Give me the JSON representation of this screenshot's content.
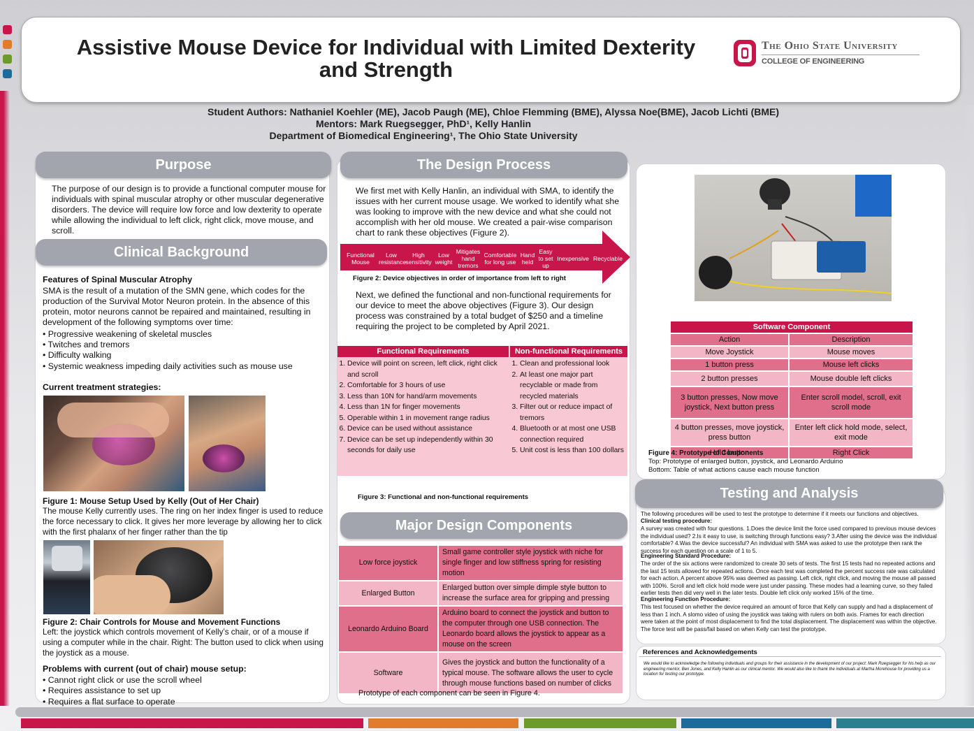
{
  "title": "Assistive Mouse Device for Individual with Limited Dexterity and Strength",
  "university": {
    "name": "The Ohio State University",
    "college": "College of Engineering"
  },
  "authors": {
    "students": "Student Authors: Nathaniel Koehler (ME), Jacob Paugh (ME), Chloe Flemming (BME), Alyssa Noe(BME), Jacob Lichti (BME)",
    "mentors": "Mentors: Mark Ruegsegger, PhD¹, Kelly Hanlin",
    "department": "Department of Biomedical Engineering¹, The Ohio State University"
  },
  "purpose": {
    "heading": "Purpose",
    "text": "The purpose of our design is to provide a functional computer mouse for individuals with spinal muscular atrophy or other muscular degenerative disorders. The device will require low force and low dexterity to operate while allowing the individual to left click, right click, move mouse, and scroll."
  },
  "clinical": {
    "heading": "Clinical Background",
    "features_title": "Features of Spinal Muscular Atrophy",
    "features_text": "SMA is the result of a mutation of the SMN gene, which codes for the production of the Survival Motor Neuron protein. In the absence of this protein, motor neurons cannot be repaired and maintained, resulting in development of the following symptoms over time:",
    "symptoms": [
      "• Progressive weakening of skeletal muscles",
      "• Twitches and tremors",
      "• Difficulty walking",
      "• Systemic weakness impeding daily activities such as mouse use"
    ],
    "treatment_title": "Current treatment strategies:",
    "fig1_caption": "Figure 1: Mouse Setup Used by Kelly (Out of Her Chair)",
    "fig1_text": "The mouse Kelly currently uses. The ring on her index finger is used to reduce the force necessary to click. It gives her more leverage by allowing her to click with the first phalanx of her finger rather than the tip",
    "fig2_caption": "Figure 2: Chair Controls for Mouse and Movement Functions",
    "fig2_text": "Left: the joystick which controls movement of Kelly’s chair, or of a mouse if using a computer while in the chair. Right: The button used to click when using the joystick as a mouse.",
    "problems_title": "Problems with current (out of chair) mouse setup:",
    "problems": [
      "• Cannot right click or use the scroll wheel",
      "• Requires assistance to set up",
      "• Requires a flat surface to operate"
    ]
  },
  "design": {
    "heading": "The Design Process",
    "intro": "We first met with Kelly Hanlin, an individual with SMA, to identify the issues with her current mouse usage. We worked to identify what she was looking to improve with the new device and what she could not accomplish with her old mouse. We created a pair-wise comparison chart to rank these objectives (Figure 2).",
    "objectives": [
      "Functional Mouse",
      "Low resistance",
      "High sensitivity",
      "Low weight",
      "Mitigates hand tremors",
      "Comfortable for long use",
      "Hand held",
      "Easy to set up",
      "Inexpensive",
      "Recyclable"
    ],
    "objectives_caption": "Figure 2: Device objectives in order of importance from left to right",
    "next": "Next, we defined the functional and non-functional requirements for our device to meet the above objectives (Figure 3). Our design process was constrained by a total budget of $250 and a timeline requiring the project to be completed by April 2021.",
    "functional_header": "Functional Requirements",
    "nonfunctional_header": "Non-functional Requirements",
    "functional": [
      "Device will point on screen, left click, right click and scroll",
      "Comfortable for 3 hours of use",
      "Less than 10N for hand/arm movements",
      "Less than 1N for finger movements",
      "Operable within 1 in movement range radius",
      "Device can be used without assistance",
      "Device can be set up independently within 30 seconds for daily use"
    ],
    "nonfunctional": [
      "Clean and professional look",
      "At least one major part recyclable or made from recycled materials",
      "Filter out or reduce impact of tremors",
      "Bluetooth or at most one USB connection required",
      "Unit cost is less than 100 dollars"
    ],
    "fig3_caption": "Figure 3: Functional and non-functional requirements"
  },
  "components": {
    "heading": "Major Design Components",
    "rows": [
      {
        "name": "Low force joystick",
        "desc": "Small game controller style joystick with niche for single finger and low stiffness spring for resisting motion"
      },
      {
        "name": "Enlarged Button",
        "desc": "Enlarged button over simple dimple style button to increase the surface area for gripping and pressing"
      },
      {
        "name": "Leonardo Arduino Board",
        "desc": "Arduino board to connect the joystick and button to the computer through one USB connection. The Leonardo board allows the joystick to appear as a mouse on the screen"
      },
      {
        "name": "Software",
        "desc": "Gives the joystick and button the functionality of a typical mouse. The software allows the user to cycle through mouse functions based on number of clicks"
      }
    ],
    "note": "Prototype of each component can be seen in Figure 4."
  },
  "software": {
    "title": "Software Component",
    "col_action": "Action",
    "col_desc": "Description",
    "rows": [
      {
        "action": "Move Joystick",
        "desc": "Mouse moves"
      },
      {
        "action": "1 button press",
        "desc": "Mouse left clicks"
      },
      {
        "action": "2 button presses",
        "desc": "Mouse double left clicks"
      },
      {
        "action": "3 button presses, Now move joystick, Next button press",
        "desc": "Enter scroll model, scroll, exit scroll mode"
      },
      {
        "action": "4 button presses, move joystick, press button",
        "desc": "Enter left click hold mode, select, exit mode"
      },
      {
        "action": "Hold button",
        "desc": "Right Click"
      }
    ],
    "fig4_caption": "Figure 4: Prototype of Components",
    "fig4_top": "Top: Prototype of enlarged button, joystick, and Leonardo Arduino",
    "fig4_bottom": "Bottom: Table of what actions cause each mouse function"
  },
  "testing": {
    "heading": "Testing and Analysis",
    "intro": "The following procedures will be used to test the prototype to determine if it meets our functions and objectives.",
    "clinical_title": "Clinical testing procedure:",
    "clinical_text": "A survey was created with four questions. 1.Does the device limit the force used compared to previous mouse devices the individual used? 2.Is it easy to use, is switching through functions easy? 3.After using the device was the individual comfortable? 4.Was the device successful? An individual with SMA was asked to use the prototype then rank the success for each question on a scale of 1 to 5.",
    "standard_title": "Engineering Standard Procedure:",
    "standard_text": "The order of the six actions were randomized to create 30 sets of tests. The first 15 tests had no repeated actions and the last 15 tests allowed for repeated actions. Once each test was completed the percent success rate was calculated for each action. A percent above 95% was deemed as passing. Left click, right click, and moving the mouse all passed with 100%. Scroll and left click hold mode were just under passing. These modes had a learning curve, so they failed earlier tests then did very well in the later tests. Double left click only worked 15% of the time.",
    "function_title": "Engineering Function Procedure:",
    "function_text": "This test focused on whether the device required an amount of force that Kelly can supply and had a displacement of less than 1 inch. A slomo video of using the joystick was taking with rulers on both axis. Frames for each direction were taken at the point of most displacement to find the total displacement. The displacement was within the objective. The force test will be pass/fail based on when Kelly can test the prototype."
  },
  "references": {
    "heading": "References and Acknowledgements",
    "text": "We would like to acknowledge the following individuals and groups for their assistance in the development of our project: Mark Ruegsegger for his help as our engineering mentor, Ben Jones, and Kelly Hanlin as our clinical mentor. We would also like to thank the individuals at Martha Morehouse for providing us a location for testing our prototype."
  },
  "colors": {
    "accent": "#c8154a",
    "header_gray": "#a3a5ae",
    "pink_dark": "#e06f8b",
    "pink_light": "#f3b6c6"
  }
}
